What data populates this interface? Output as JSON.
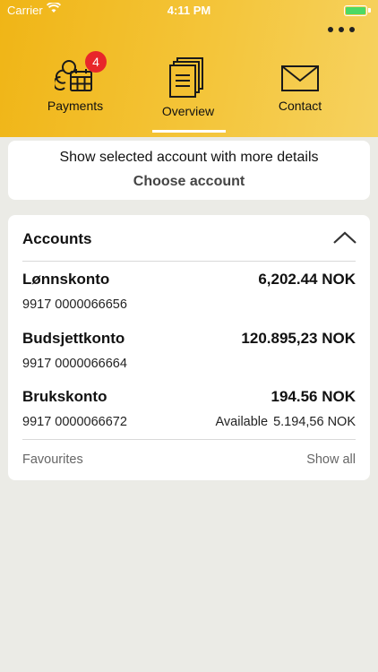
{
  "status_bar": {
    "carrier": "Carrier",
    "time": "4:11 PM",
    "battery_color": "#4cd964"
  },
  "header": {
    "more_icon": "more-dots-icon",
    "tabs": [
      {
        "label": "Payments",
        "icon": "calendar-coins-icon",
        "badge": "4"
      },
      {
        "label": "Overview",
        "icon": "documents-icon",
        "selected": true
      },
      {
        "label": "Contact",
        "icon": "envelope-icon"
      }
    ],
    "badge_color": "#e8262a",
    "gradient_colors": [
      "#f0b516",
      "#f6d260"
    ]
  },
  "account_selector": {
    "hint": "Show selected account with more details",
    "action": "Choose account"
  },
  "accounts": {
    "title": "Accounts",
    "collapse_icon": "chevron-up-icon",
    "items": [
      {
        "name": "Lønnskonto",
        "balance": "6,202.44 NOK",
        "number": "9917 0000066656"
      },
      {
        "name": "Budsjettkonto",
        "balance": "120.895,23 NOK",
        "number": "9917 0000066664"
      },
      {
        "name": "Brukskonto",
        "balance": "194.56 NOK",
        "number": "9917 0000066672",
        "available_label": "Available",
        "available_value": "5.194,56 NOK"
      }
    ],
    "favourites_label": "Favourites",
    "show_all_label": "Show all"
  }
}
